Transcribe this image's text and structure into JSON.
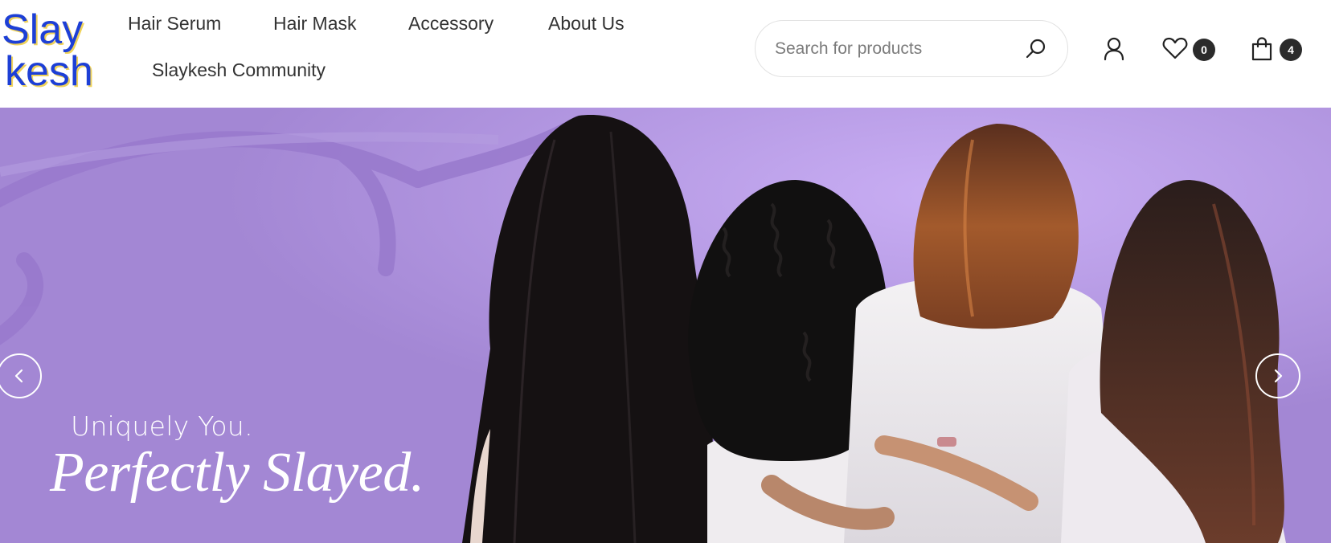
{
  "brand": {
    "logo_text_1": "Slay",
    "logo_text_2": "kesh",
    "logo_color": "#1d3fd6",
    "logo_shadow": "#f0d35a"
  },
  "nav": {
    "items": [
      {
        "label": "Hair Serum"
      },
      {
        "label": "Hair Mask"
      },
      {
        "label": "Accessory"
      },
      {
        "label": "About Us"
      },
      {
        "label": "Slaykesh Community"
      }
    ]
  },
  "search": {
    "placeholder": "Search for products",
    "value": ""
  },
  "header_icons": {
    "account": "user-icon",
    "wishlist": "heart-icon",
    "cart": "shopping-bag-icon"
  },
  "counts": {
    "wishlist": "0",
    "cart": "4"
  },
  "hero": {
    "tagline_line1": "Uniquely You.",
    "tagline_line2": "Perfectly Slayed.",
    "background_color": "#a387d4"
  },
  "slider": {
    "prev_icon": "chevron-left-icon",
    "next_icon": "chevron-right-icon"
  }
}
